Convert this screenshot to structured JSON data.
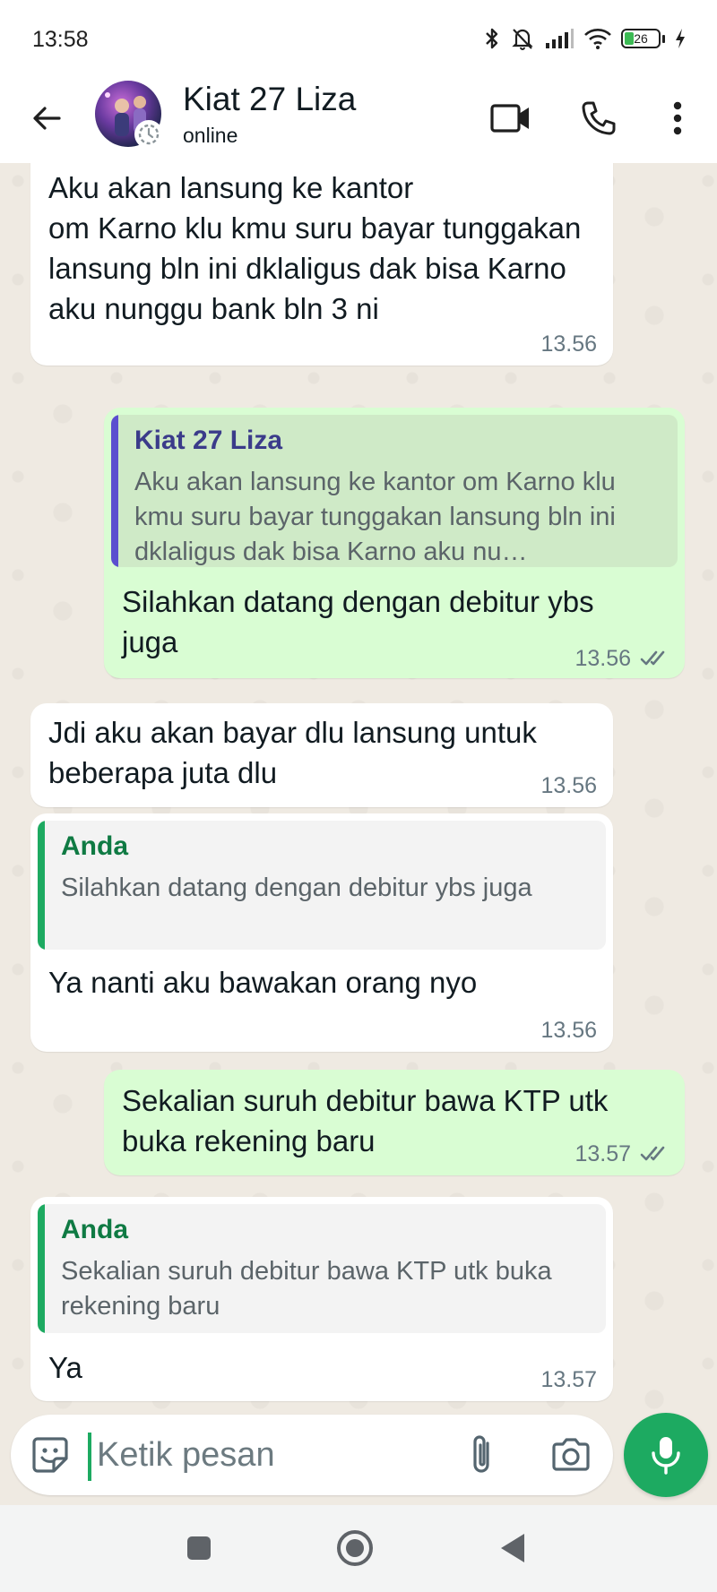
{
  "status_bar": {
    "time": "13:58",
    "battery": "26"
  },
  "header": {
    "contact_name": "Kiat 27 Liza",
    "contact_status": "online"
  },
  "messages": [
    {
      "direction": "incoming",
      "text": "Aku akan lansung ke kantor\nom Karno klu kmu suru bayar tunggakan lansung bln ini dklaligus dak bisa Karno aku nunggu bank bln 3 ni",
      "time": "13.56"
    },
    {
      "direction": "outgoing",
      "quote": {
        "author": "Kiat 27 Liza",
        "text": "Aku akan lansung ke kantor om Karno klu kmu suru bayar tunggakan lansung bln ini dklaligus dak bisa Karno aku nu…"
      },
      "text": "Silahkan datang dengan debitur ybs juga",
      "time": "13.56",
      "read": true
    },
    {
      "direction": "incoming",
      "text": "Jdi aku akan bayar dlu lansung untuk beberapa juta dlu",
      "time": "13.56"
    },
    {
      "direction": "incoming",
      "quote": {
        "author": "Anda",
        "text": "Silahkan datang dengan debitur ybs juga"
      },
      "text": "Ya nanti aku bawakan orang nyo",
      "time": "13.56"
    },
    {
      "direction": "outgoing",
      "text": "Sekalian suruh debitur bawa KTP utk buka rekening baru",
      "time": "13.57",
      "read": true
    },
    {
      "direction": "incoming",
      "quote": {
        "author": "Anda",
        "text": "Sekalian suruh debitur bawa KTP utk buka rekening baru"
      },
      "text": "Ya",
      "time": "13.57"
    }
  ],
  "composer": {
    "placeholder": "Ketik pesan"
  },
  "colors": {
    "outgoing_bubble": "#d9fdd3",
    "incoming_bubble": "#ffffff",
    "accent": "#1daa61",
    "quote_bar_contact": "#5b4fcf",
    "quote_bar_self": "#1daa61"
  },
  "icons": [
    "back-arrow-icon",
    "video-call-icon",
    "phone-icon",
    "more-vert-icon",
    "sticker-icon",
    "attach-icon",
    "camera-icon",
    "mic-icon",
    "read-ticks-icon"
  ]
}
